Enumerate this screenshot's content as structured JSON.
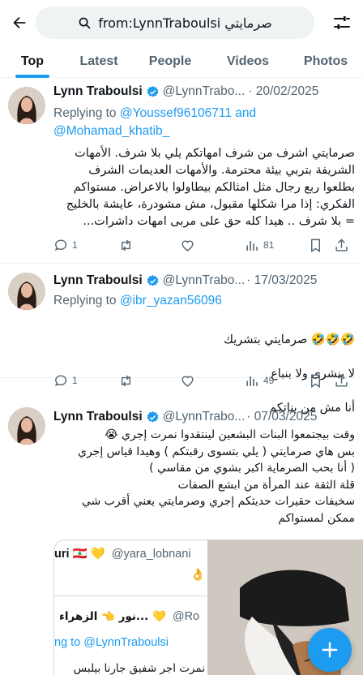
{
  "search": {
    "query": "from:LynnTraboulsi صرمايتي"
  },
  "tabs": [
    {
      "label": "Top",
      "active": true
    },
    {
      "label": "Latest"
    },
    {
      "label": "People"
    },
    {
      "label": "Videos"
    },
    {
      "label": "Photos"
    }
  ],
  "tweets": [
    {
      "name": "Lynn Traboulsi",
      "handle": "@LynnTrabo...",
      "date": "· 20/02/2025",
      "replying_prefix": "Replying to ",
      "replying_mention_1": "@Youssef96106711",
      "replying_and": " and",
      "replying_mention_2": "@Mohamad_khatib_",
      "text": "صرمايتي اشرف من شرف امهاتكم يلي بلا شرف. الأمهات الشريفة بتربي بيئة محترمة. والأمهات العديمات الشرف بطلعوا ربع رجال مثل امثالكم بيطاولوا بالاعراض. مستواكم الفكري: إذا مرا شكلها مقبول، مش مشودرة، عايشة بالخليج = بلا شرف .. هيدا كله حق على مربى امهات داشرات...",
      "replies": "1",
      "views": "81"
    },
    {
      "name": "Lynn Traboulsi",
      "handle": "@LynnTrabo...",
      "date": "· 17/03/2025",
      "replying_prefix": "Replying to ",
      "replying_mention_1": "@ibr_yazan56096",
      "text_line_1": "🤣🤣🤣 صرمايتي بتشريك",
      "text_line_2": "لا بنشرى ولا بنباع",
      "text_line_3": "أنا مش من بناتكم",
      "replies": "1",
      "views": "49"
    },
    {
      "name": "Lynn Traboulsi",
      "handle": "@LynnTrabo...",
      "date": "· 07/03/2025",
      "text": "وقت بيجتمعوا البنات البشعين لينتقدوا نمرت إجري 😭\nبس هاي صرمايتي ( يلي بتسوى رقبتكم ) وهيدا قياس إجري\n( أنا بحب الصرماية اكبر بشوي من مقاسي )\nقلة الثقة عند المرأة من ابشع الصفات\nسخيفات حقيرات حديثكم إجري وصرمايتي يعني أقرب شي\nممكن لمستواكم",
      "quote": {
        "name_fragment": "uri 🇱🇧 💛",
        "handle_fragment": "@yara_lobnani",
        "emoji_row": "👌",
        "name_2": "نور 👈 الزهراء... 💛",
        "handle_2": "@Ro",
        "reply_to": "ng to @LynnTraboulsi",
        "text_fragment": "نمرت اجر شفيق جارنا بيلبس"
      }
    }
  ],
  "colors": {
    "accent": "#1d9bf0",
    "text": "#0f1419",
    "secondary": "#536471",
    "verified": "#1d9bf0"
  },
  "icons": [
    "back-arrow-icon",
    "search-icon",
    "filter-icon",
    "verified-icon",
    "reply-icon",
    "retweet-icon",
    "like-icon",
    "views-icon",
    "bookmark-icon",
    "share-icon",
    "compose-plus-icon"
  ]
}
